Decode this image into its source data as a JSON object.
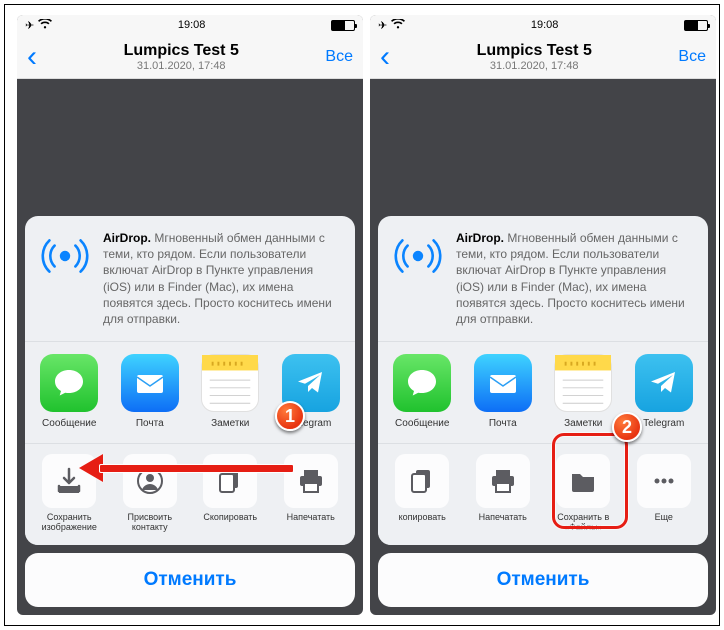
{
  "status": {
    "time": "19:08"
  },
  "nav": {
    "title": "Lumpics Test 5",
    "subtitle": "31.01.2020, 17:48",
    "all": "Все"
  },
  "airdrop": {
    "bold": "AirDrop.",
    "text": " Мгновенный обмен данными с теми, кто рядом. Если пользователи включат AirDrop в Пункте управления (iOS) или в Finder (Mac), их имена появятся здесь. Просто коснитесь имени для отправки."
  },
  "apps": {
    "a0": "Сообщение",
    "a1": "Почта",
    "a2": "Заметки",
    "a3": "Telegram"
  },
  "actsL": {
    "a0": "Сохранить изображение",
    "a1": "Присвоить контакту",
    "a2": "Скопировать",
    "a3": "Напечатать"
  },
  "actsR": {
    "a0": "копировать",
    "a1": "Напечатать",
    "a2": "Сохранить в «Файлы»",
    "a3": "Еще"
  },
  "cancel": "Отменить",
  "markers": {
    "m1": "1",
    "m2": "2"
  }
}
